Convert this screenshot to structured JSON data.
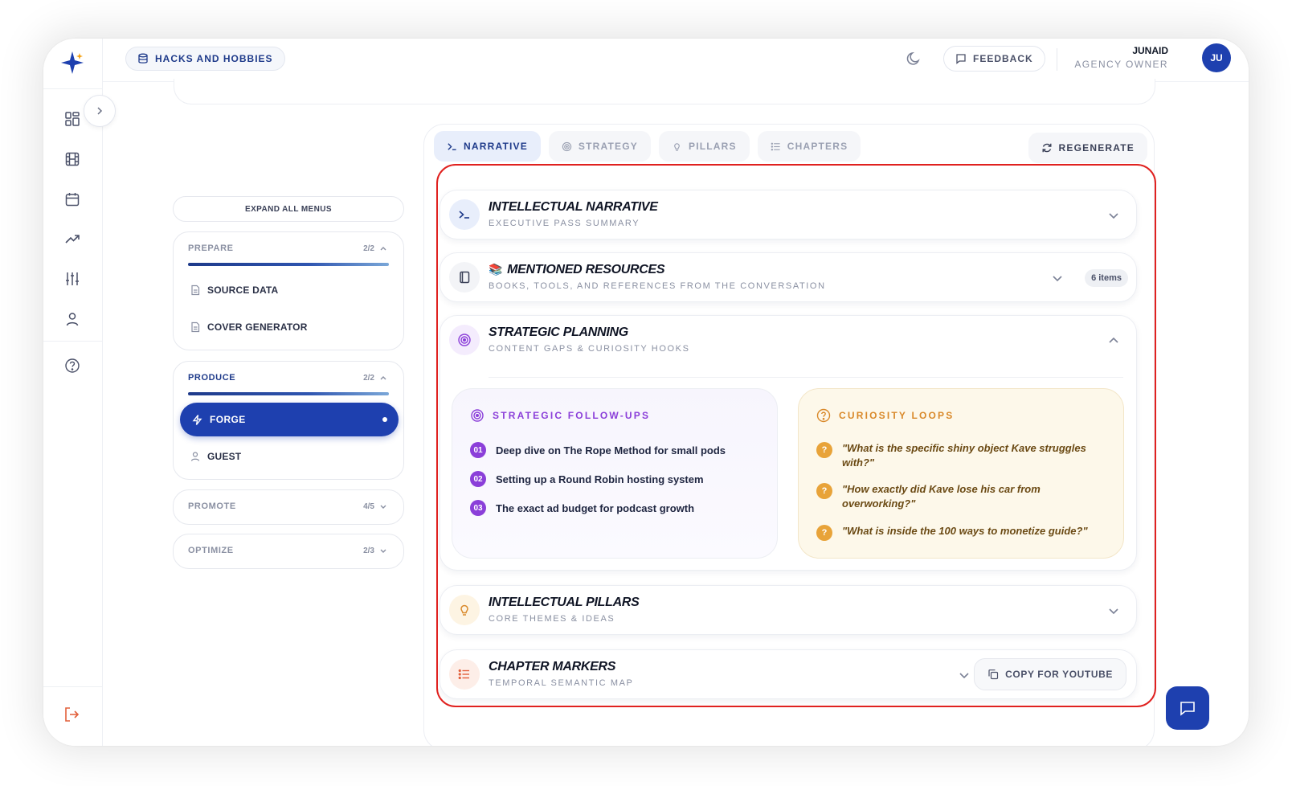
{
  "header": {
    "workspace": "HACKS AND HOBBIES",
    "feedback_label": "FEEDBACK",
    "user_name": "JUNAID",
    "user_role": "AGENCY OWNER",
    "avatar_initials": "JU"
  },
  "sidebar_rail": {
    "icons": [
      "grid-icon",
      "film-icon",
      "calendar-icon",
      "trending-icon",
      "sliders-icon",
      "user-icon",
      "help-icon",
      "logout-icon"
    ]
  },
  "menu": {
    "expand_all": "EXPAND ALL MENUS",
    "groups": [
      {
        "name": "PREPARE",
        "count": "2/2",
        "items": [
          "SOURCE DATA",
          "COVER GENERATOR"
        ]
      },
      {
        "name": "PRODUCE",
        "count": "2/2",
        "items": [
          "FORGE",
          "GUEST"
        ]
      },
      {
        "name": "PROMOTE",
        "count": "4/5"
      },
      {
        "name": "OPTIMIZE",
        "count": "2/3"
      }
    ]
  },
  "tabs": [
    {
      "label": "NARRATIVE",
      "active": true
    },
    {
      "label": "STRATEGY"
    },
    {
      "label": "PILLARS"
    },
    {
      "label": "CHAPTERS"
    }
  ],
  "regenerate_label": "REGENERATE",
  "sections": {
    "narrative": {
      "title": "INTELLECTUAL NARRATIVE",
      "subtitle": "EXECUTIVE PASS SUMMARY"
    },
    "resources": {
      "emoji": "📚",
      "title": "MENTIONED RESOURCES",
      "subtitle": "BOOKS, TOOLS, AND REFERENCES FROM THE CONVERSATION",
      "badge": "6 items"
    },
    "strategic": {
      "title": "STRATEGIC PLANNING",
      "subtitle": "CONTENT GAPS & CURIOSITY HOOKS",
      "followups": {
        "heading": "STRATEGIC FOLLOW-UPS",
        "items": [
          {
            "num": "01",
            "text": "Deep dive on The Rope Method for small pods"
          },
          {
            "num": "02",
            "text": "Setting up a Round Robin hosting system"
          },
          {
            "num": "03",
            "text": "The exact ad budget for podcast growth"
          }
        ]
      },
      "loops": {
        "heading": "CURIOSITY LOOPS",
        "items": [
          "\"What is the specific shiny object Kave struggles with?\"",
          "\"How exactly did Kave lose his car from overworking?\"",
          "\"What is inside the 100 ways to monetize guide?\""
        ]
      }
    },
    "pillars": {
      "title": "INTELLECTUAL PILLARS",
      "subtitle": "CORE THEMES & IDEAS"
    },
    "chapters": {
      "title": "CHAPTER MARKERS",
      "subtitle": "TEMPORAL SEMANTIC MAP",
      "copy_label": "COPY FOR YOUTUBE"
    }
  },
  "colors": {
    "brand": "#1e40af",
    "highlight": "#e0211f",
    "followup_accent": "#8b3fd9",
    "loop_accent": "#e8a339"
  }
}
